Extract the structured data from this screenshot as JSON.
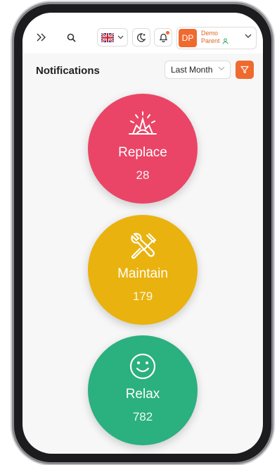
{
  "header": {
    "user": {
      "initials": "DP",
      "name_line1": "Demo",
      "name_line2": "Parent"
    }
  },
  "notifications": {
    "title": "Notifications",
    "period": "Last Month",
    "categories": [
      {
        "label": "Replace",
        "count": "28",
        "color": "#ea4566",
        "icon": "explosion-icon"
      },
      {
        "label": "Maintain",
        "count": "179",
        "color": "#e9b20e",
        "icon": "tools-icon"
      },
      {
        "label": "Relax",
        "count": "782",
        "color": "#2bb07f",
        "icon": "smiley-icon"
      }
    ]
  },
  "colors": {
    "accent": "#ef6a2f",
    "background": "#f7f7f8"
  }
}
